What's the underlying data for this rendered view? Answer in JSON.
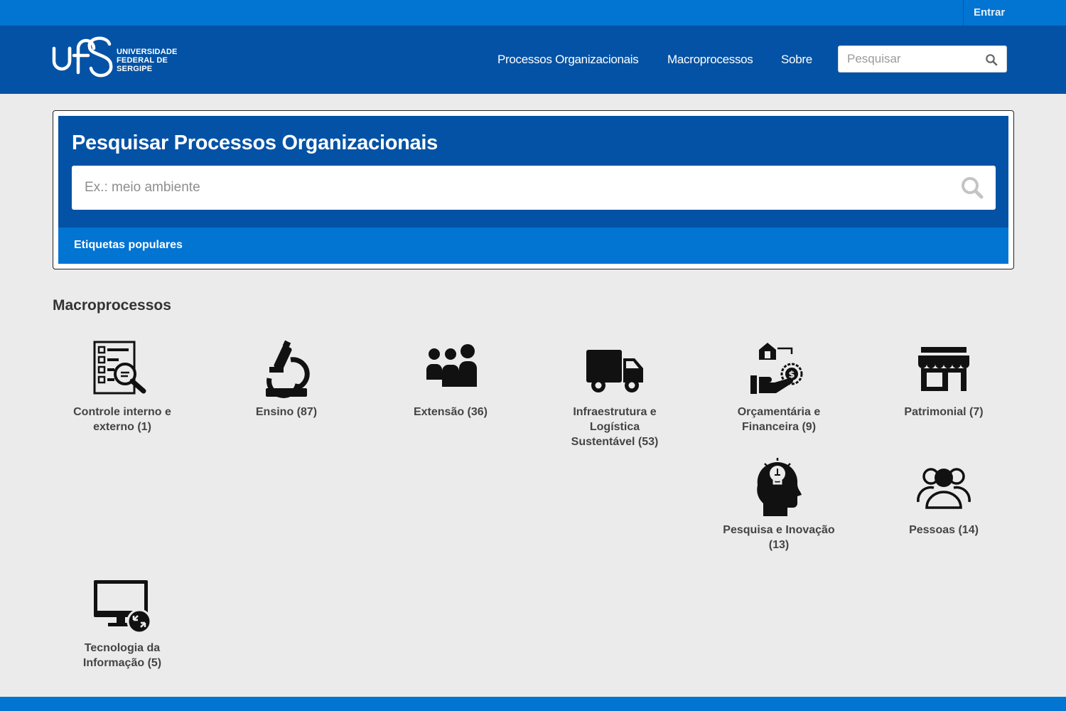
{
  "topbar": {
    "login_label": "Entrar"
  },
  "header": {
    "logo_lines": [
      "UNIVERSIDADE",
      "FEDERAL DE",
      "SERGIPE"
    ],
    "logo_mark": "ufs",
    "nav": [
      {
        "label": "Processos Organizacionais"
      },
      {
        "label": "Macroprocessos"
      },
      {
        "label": "Sobre"
      }
    ],
    "search_placeholder": "Pesquisar"
  },
  "search_panel": {
    "title": "Pesquisar Processos Organizacionais",
    "placeholder": "Ex.: meio ambiente",
    "tags_label": "Etiquetas populares"
  },
  "macroprocessos": {
    "title": "Macroprocessos",
    "items": [
      {
        "label": "Controle interno e externo (1)",
        "icon": "audit-document-icon"
      },
      {
        "label": "Ensino (87)",
        "icon": "microscope-icon"
      },
      {
        "label": "Extensão (36)",
        "icon": "group-people-icon"
      },
      {
        "label": "Infraestrutura e Logística Sustentável (53)",
        "icon": "truck-icon"
      },
      {
        "label": "Orçamentária e Financeira (9)",
        "icon": "finance-hand-icon"
      },
      {
        "label": "Patrimonial (7)",
        "icon": "store-icon"
      },
      {
        "label": "Pesquisa e Inovação (13)",
        "icon": "head-lightbulb-icon"
      },
      {
        "label": "Pessoas (14)",
        "icon": "people-outline-icon"
      },
      {
        "label": "Tecnologia da Informação (5)",
        "icon": "remote-desktop-icon"
      }
    ]
  },
  "colors": {
    "topbar": "#0274d2",
    "navbar": "#0452a5",
    "background": "#ebebeb"
  }
}
